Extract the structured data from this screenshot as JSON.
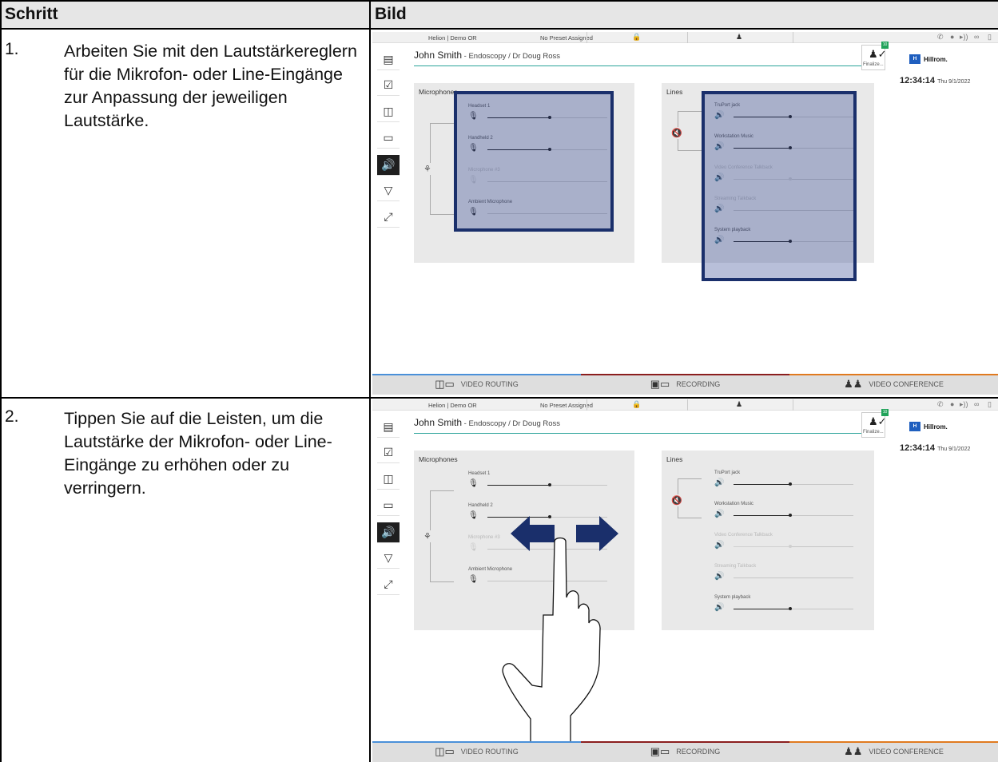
{
  "table": {
    "header": {
      "step_col": "Schritt",
      "image_col": "Bild"
    },
    "rows": [
      {
        "num": "1.",
        "text": "Arbeiten Sie mit den Lautstärkereglern für die Mikrofon- oder Line-Eingänge zur Anpassung der jeweiligen Lautstärke."
      },
      {
        "num": "2.",
        "text": "Tippen Sie auf die Leisten, um die Lautstärke der Mikrofon- oder Line-Eingänge zu erhöhen oder zu verringern."
      }
    ]
  },
  "ui": {
    "topbar": {
      "location": "Helion | Demo OR",
      "preset": "No Preset Assigned"
    },
    "patient": {
      "name": "John Smith",
      "detail": " - Endoscopy / Dr Doug Ross"
    },
    "finalize": {
      "label": "Finalize...",
      "badge": "10"
    },
    "brand": {
      "logo": "H",
      "name": "Hillrom."
    },
    "clock": {
      "time": "12:34:14",
      "date": "Thu 9/1/2022"
    },
    "microphones": {
      "title": "Microphones",
      "channels": [
        {
          "label": "Headset 1",
          "level": 0.52,
          "enabled": true
        },
        {
          "label": "Handheld 2",
          "level": 0.52,
          "enabled": true
        },
        {
          "label": "Microphone #3",
          "level": 0.0,
          "enabled": false
        },
        {
          "label": "Ambient Microphone",
          "level": 0.0,
          "enabled": true
        }
      ]
    },
    "lines": {
      "title": "Lines",
      "channels": [
        {
          "label": "TruPort jack",
          "level": 0.47,
          "enabled": true
        },
        {
          "label": "Workstation Music",
          "level": 0.47,
          "enabled": true
        },
        {
          "label": "Video Conference Talkback",
          "level": 0.47,
          "enabled": false
        },
        {
          "label": "Streaming Talkback",
          "level": 0.0,
          "enabled": false
        },
        {
          "label": "System playback",
          "level": 0.47,
          "enabled": true
        }
      ]
    },
    "bottom_tabs": [
      {
        "label": "VIDEO ROUTING",
        "color": "#4a90d9"
      },
      {
        "label": "RECORDING",
        "color": "#8b1e1e"
      },
      {
        "label": "VIDEO CONFERENCE",
        "color": "#e07a1f"
      }
    ],
    "highlight_color": "#1a2f6b",
    "arrow_color": "#1a2f6b",
    "active_nav": "audio"
  }
}
